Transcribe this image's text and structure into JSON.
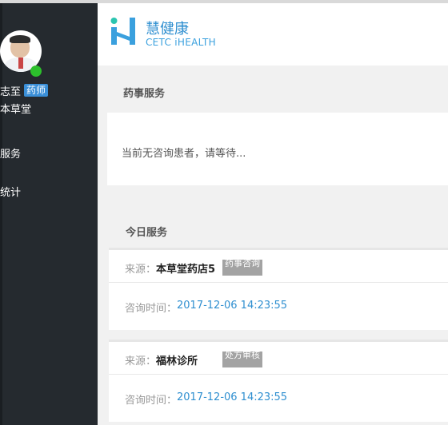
{
  "sidebar": {
    "user": {
      "name": "志至",
      "role_badge": "药师",
      "store": "本草堂",
      "status_color": "#2cc02c"
    },
    "nav": [
      {
        "label": "服务"
      },
      {
        "label": "统计"
      }
    ]
  },
  "header": {
    "brand_name": "慧健康",
    "brand_sub": "CETC iHEALTH",
    "brand_color": "#2f8fd0"
  },
  "pharmacy_service": {
    "title": "药事服务",
    "waiting_message": "当前无咨询患者，请等待..."
  },
  "today_service": {
    "title": "今日服务",
    "items": [
      {
        "source_label": "来源：",
        "source": "本草堂药店5",
        "type_badge": "药事咨询",
        "time_label": "咨询时间：",
        "time": "2017-12-06 14:23:55"
      },
      {
        "source_label": "来源：",
        "source": "福林诊所",
        "type_badge": "处方审核",
        "time_label": "咨询时间：",
        "time": "2017-12-06 14:23:55"
      }
    ]
  }
}
